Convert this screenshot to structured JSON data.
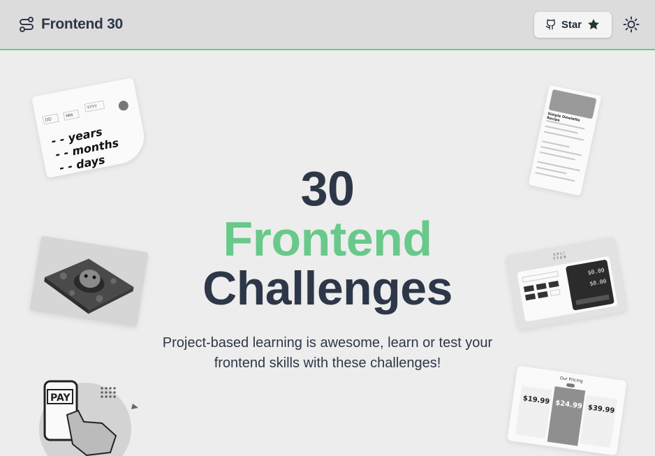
{
  "header": {
    "brand_name": "Frontend 30",
    "brand_icon": "route-icon",
    "star_label": "Star",
    "github_icon": "github-icon",
    "star_icon": "star-icon",
    "theme_icon": "sun-icon"
  },
  "hero": {
    "line1": "30",
    "line2": "Frontend",
    "line3": "Challenges",
    "subtitle": "Project-based learning is awesome, learn or test your frontend skills with these challenges!"
  },
  "colors": {
    "accent": "#68c98a",
    "text": "#2d3748",
    "background": "#ededed",
    "header_bg": "#dcdcdc"
  },
  "cards": {
    "age": {
      "fields": [
        "DD",
        "MM",
        "YYYY"
      ],
      "lines": [
        "- - years",
        "- - months",
        "- - days"
      ]
    },
    "recipe": {
      "title": "Simple Omelette Recipe"
    },
    "tip": {
      "amount1": "$0.00",
      "amount2": "$0.00",
      "logo": "SPLI TTER"
    },
    "pricing": {
      "title": "Our Pricing",
      "prices": [
        "$19.99",
        "$24.99",
        "$39.99"
      ]
    },
    "pay": {
      "label": "PAY"
    }
  }
}
